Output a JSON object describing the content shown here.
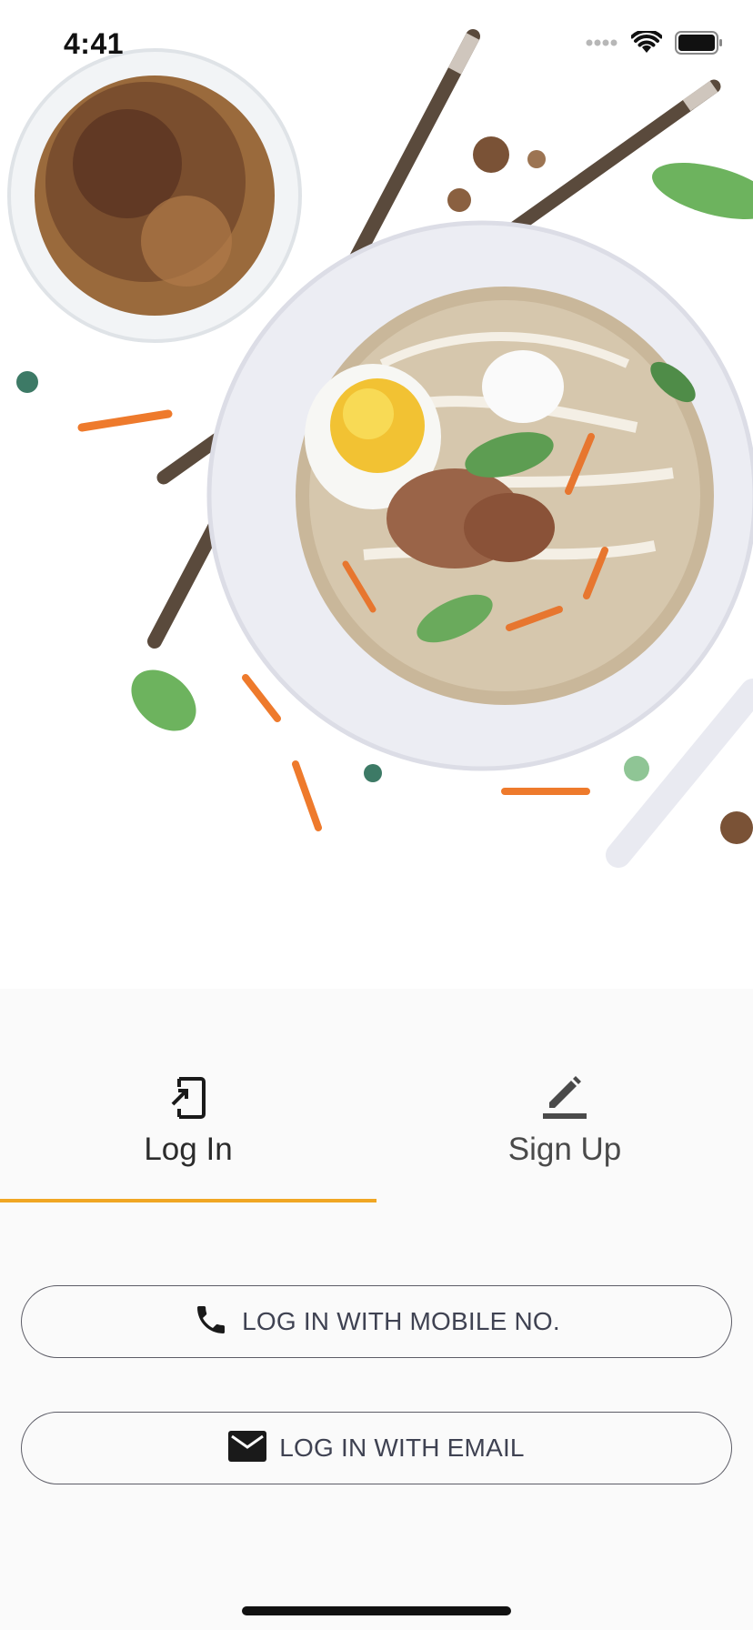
{
  "status_bar": {
    "time": "4:41"
  },
  "tabs": [
    {
      "label": "Log In",
      "icon": "login-phone-icon",
      "active": true
    },
    {
      "label": "Sign Up",
      "icon": "edit-pencil-icon",
      "active": false
    }
  ],
  "buttons": {
    "mobile_label": "LOG IN WITH MOBILE NO.",
    "email_label": "LOG IN WITH EMAIL"
  },
  "colors": {
    "accent": "#f0a623",
    "text": "#3f4252",
    "panel_bg": "#fafafa"
  },
  "hero": {
    "illustration": "watercolor-noodle-soup-illustration"
  }
}
